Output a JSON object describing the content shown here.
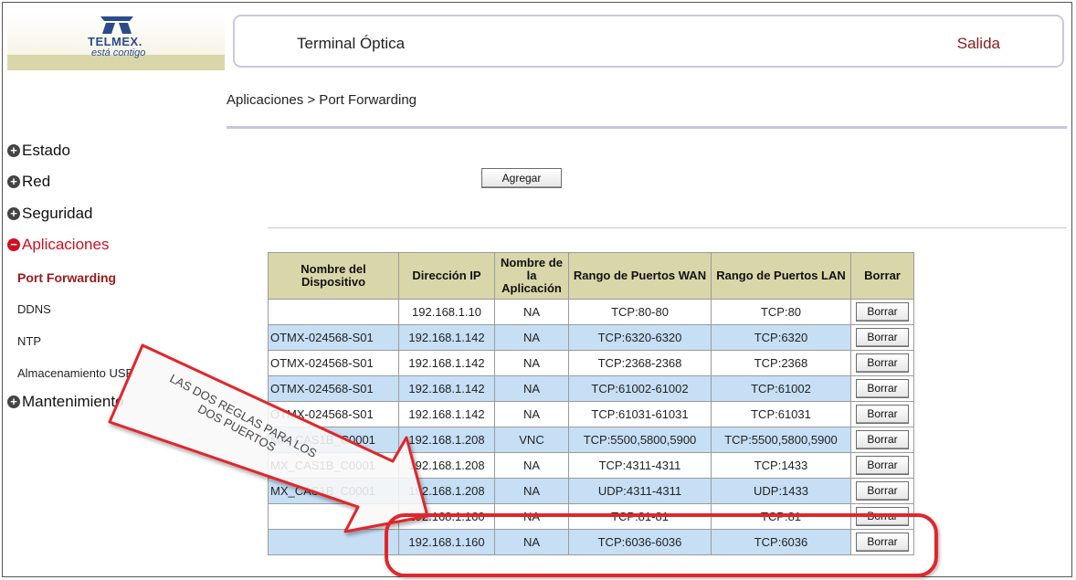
{
  "logo": {
    "name": "TELMEX.",
    "tagline": "está contigo"
  },
  "header": {
    "title": "Terminal Óptica",
    "exit_label": "Salida"
  },
  "breadcrumb": "Aplicaciones > Port Forwarding",
  "sidebar": {
    "items": [
      {
        "label": "Estado",
        "icon": "plus-icon"
      },
      {
        "label": "Red",
        "icon": "plus-icon"
      },
      {
        "label": "Seguridad",
        "icon": "plus-icon"
      },
      {
        "label": "Aplicaciones",
        "icon": "minus-icon"
      },
      {
        "label": "Mantenimiento",
        "icon": "plus-icon"
      }
    ],
    "subitems": [
      "Port Forwarding",
      "DDNS",
      "NTP",
      "Almacenamiento USB"
    ]
  },
  "add_button_label": "Agregar",
  "table": {
    "headers": [
      "Nombre del Dispositivo",
      "Dirección IP",
      "Nombre de la Aplicación",
      "Rango de Puertos WAN",
      "Rango de Puertos LAN",
      "Borrar"
    ],
    "delete_label": "Borrar",
    "rows": [
      {
        "device": "",
        "ip": "192.168.1.10",
        "app": "NA",
        "wan": "TCP:80-80",
        "lan": "TCP:80"
      },
      {
        "device": "OTMX-024568-S01",
        "ip": "192.168.1.142",
        "app": "NA",
        "wan": "TCP:6320-6320",
        "lan": "TCP:6320"
      },
      {
        "device": "OTMX-024568-S01",
        "ip": "192.168.1.142",
        "app": "NA",
        "wan": "TCP:2368-2368",
        "lan": "TCP:2368"
      },
      {
        "device": "OTMX-024568-S01",
        "ip": "192.168.1.142",
        "app": "NA",
        "wan": "TCP:61002-61002",
        "lan": "TCP:61002"
      },
      {
        "device": "OTMX-024568-S01",
        "ip": "192.168.1.142",
        "app": "NA",
        "wan": "TCP:61031-61031",
        "lan": "TCP:61031"
      },
      {
        "device": "MX_CAS1B_C0001",
        "ip": "192.168.1.208",
        "app": "VNC",
        "wan": "TCP:5500,5800,5900",
        "lan": "TCP:5500,5800,5900"
      },
      {
        "device": "MX_CAS1B_C0001",
        "ip": "192.168.1.208",
        "app": "NA",
        "wan": "TCP:4311-4311",
        "lan": "TCP:1433"
      },
      {
        "device": "MX_CAS1B_C0001",
        "ip": "192.168.1.208",
        "app": "NA",
        "wan": "UDP:4311-4311",
        "lan": "UDP:1433"
      },
      {
        "device": "",
        "ip": "192.168.1.160",
        "app": "NA",
        "wan": "TCP:81-81",
        "lan": "TCP:81"
      },
      {
        "device": "",
        "ip": "192.168.1.160",
        "app": "NA",
        "wan": "TCP:6036-6036",
        "lan": "TCP:6036"
      }
    ]
  },
  "annotation": {
    "line1": "LAS DOS REGLAS PARA LOS",
    "line2": "DOS PUERTOS"
  },
  "colors": {
    "header_bg": "#d9d6a9",
    "row_alt": "#c6dff5",
    "accent_red": "#e1262b",
    "active_link": "#9b1b1b"
  }
}
